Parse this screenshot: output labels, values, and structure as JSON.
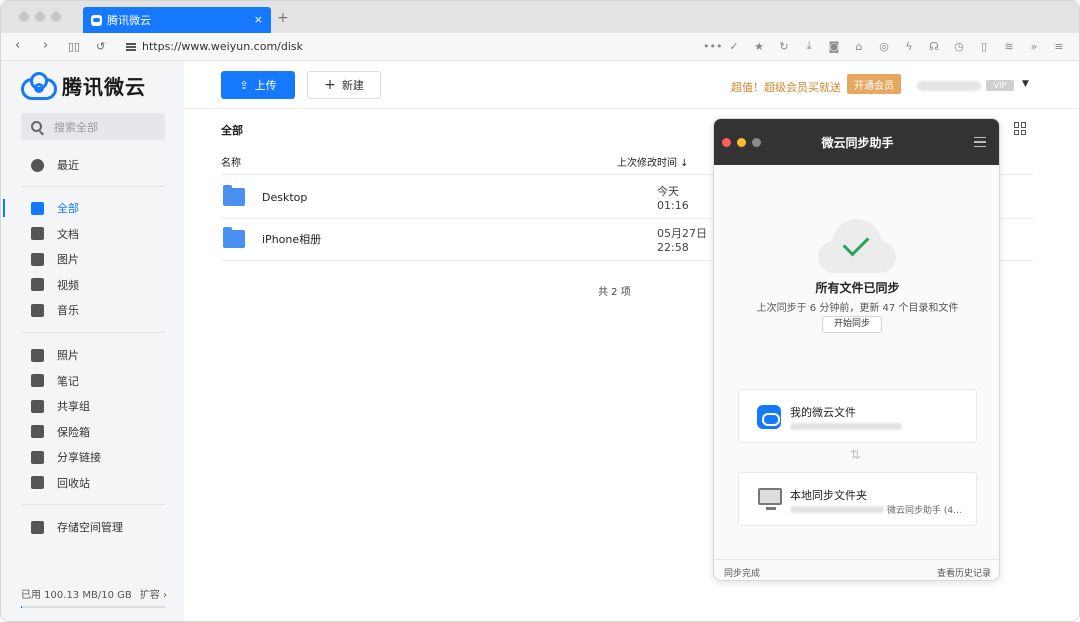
{
  "browser": {
    "tab_title": "腾讯微云",
    "tab_close": "×",
    "new_tab": "+",
    "url": "https://www.weiyun.com/disk",
    "nav": {
      "back": "‹",
      "forward": "›"
    },
    "toolbar_icons": [
      "more-icon",
      "check-icon",
      "star-icon",
      "reload-icon",
      "download-icon",
      "camera-icon",
      "extension-icon",
      "compass-icon",
      "bolt-icon",
      "headphones-icon",
      "clock-icon",
      "bookmark-icon",
      "rss-icon",
      "overflow-icon",
      "menu-icon"
    ],
    "toolbar_glyphs": [
      "•••",
      "✓",
      "★",
      "↻",
      "⤓",
      "◙",
      "⌂",
      "◎",
      "ϟ",
      "☊",
      "◷",
      "▯",
      "≋",
      "»",
      "≡"
    ]
  },
  "app": {
    "logo_text": "腾讯微云",
    "brand_color": "#1677ff"
  },
  "sidebar": {
    "search_placeholder": "搜索全部",
    "items_group1": [
      {
        "label": "最近",
        "icon": "clock-icon"
      }
    ],
    "items_group2": [
      {
        "label": "全部",
        "icon": "all-files-icon",
        "active": true
      },
      {
        "label": "文档",
        "icon": "document-icon"
      },
      {
        "label": "图片",
        "icon": "image-icon"
      },
      {
        "label": "视频",
        "icon": "video-icon"
      },
      {
        "label": "音乐",
        "icon": "music-icon"
      }
    ],
    "items_group3": [
      {
        "label": "照片",
        "icon": "photo-icon"
      },
      {
        "label": "笔记",
        "icon": "note-icon"
      },
      {
        "label": "共享组",
        "icon": "group-icon"
      },
      {
        "label": "保险箱",
        "icon": "safe-icon"
      },
      {
        "label": "分享链接",
        "icon": "share-link-icon"
      },
      {
        "label": "回收站",
        "icon": "trash-icon"
      }
    ],
    "items_group4": [
      {
        "label": "存储空间管理",
        "icon": "broom-icon"
      }
    ],
    "storage_text": "已用 100.13 MB/10 GB",
    "expand_label": "扩容 ›",
    "storage_used_fraction": 0.01
  },
  "topbar": {
    "upload_label": "上传",
    "new_label": "新建",
    "promo_text": "超值！超级会员买就送",
    "vip_button": "开通会员",
    "vip_badge": "VIP",
    "caret": "▼"
  },
  "list": {
    "breadcrumb": "全部",
    "col_name": "名称",
    "col_modified": "上次修改时间 ↓",
    "rows": [
      {
        "name": "Desktop",
        "modified": "今天 01:16"
      },
      {
        "name": "iPhone相册",
        "modified": "05月27日 22:58"
      }
    ],
    "total": "共 2 项"
  },
  "sync_panel": {
    "title": "微云同步助手",
    "status": "所有文件已同步",
    "sub": "上次同步于 6 分钟前，更新 47 个目录和文件",
    "start_button": "开始同步",
    "cloud_card_title": "我的微云文件",
    "local_card_title": "本地同步文件夹",
    "local_path_tail": "微云同步助手 (4...",
    "arrow": "⇅",
    "footer_left": "同步完成",
    "footer_right": "查看历史记录",
    "dot_colors": [
      "#fe5f57",
      "#febc2e",
      "#8a8a8a"
    ],
    "check_color": "#27a35a"
  }
}
